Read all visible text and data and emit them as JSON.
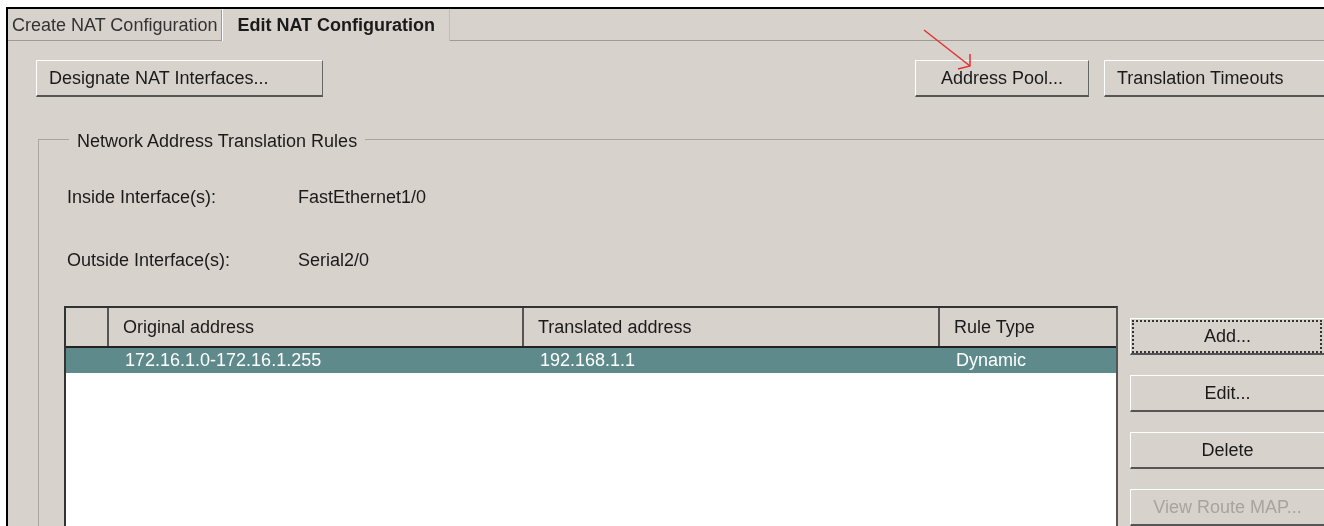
{
  "tabs": [
    {
      "label": "Create NAT Configuration",
      "selected": false
    },
    {
      "label": "Edit NAT Configuration",
      "selected": true
    }
  ],
  "top_buttons": [
    "Designate NAT Interfaces...",
    "Address Pool...",
    "Translation Timeouts"
  ],
  "group": {
    "title": "Network Address Translation Rules",
    "fields": [
      {
        "label": "Inside Interface(s):",
        "value": "FastEthernet1/0"
      },
      {
        "label": "Outside Interface(s):",
        "value": "Serial2/0"
      }
    ],
    "table": {
      "columns": [
        "Original address",
        "Translated address",
        "Rule Type"
      ],
      "rows": [
        {
          "cells": [
            "172.16.1.0-172.16.1.255",
            "192.168.1.1",
            "Dynamic"
          ],
          "selected": true
        }
      ]
    },
    "buttons": [
      {
        "label": "Add...",
        "focused": true,
        "disabled": false
      },
      {
        "label": "Edit...",
        "focused": false,
        "disabled": false
      },
      {
        "label": "Delete",
        "focused": false,
        "disabled": false
      },
      {
        "label": "View Route MAP...",
        "focused": false,
        "disabled": true
      }
    ]
  }
}
